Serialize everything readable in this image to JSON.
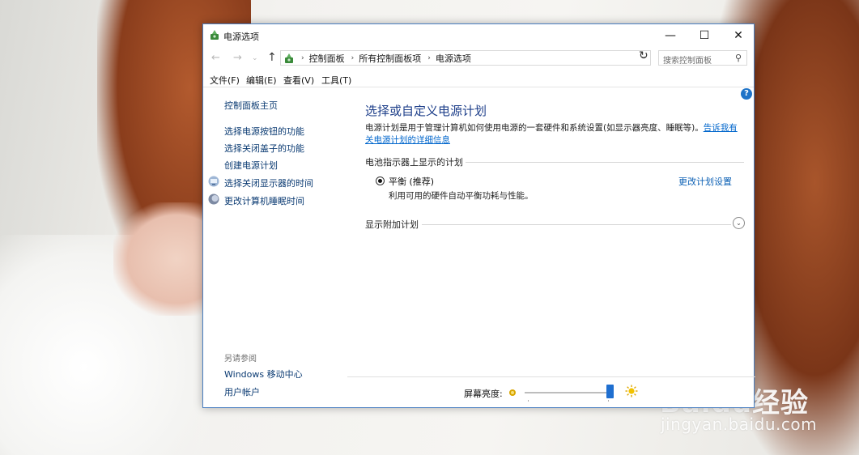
{
  "window": {
    "title": "电源选项",
    "min_glyph": "—",
    "max_glyph": "☐",
    "close_glyph": "✕"
  },
  "nav": {
    "back_glyph": "←",
    "forward_glyph": "→",
    "recent_glyph": "⌄",
    "up_glyph": "↑",
    "breadcrumbs": [
      "控制面板",
      "所有控制面板项",
      "电源选项"
    ],
    "sep_glyph": "›",
    "dropdown_glyph": "⌄",
    "refresh_glyph": "↻",
    "search_placeholder": "搜索控制面板",
    "search_glyph": "⚲"
  },
  "menu": [
    "文件(F)",
    "编辑(E)",
    "查看(V)",
    "工具(T)"
  ],
  "help_glyph": "?",
  "sidebar": {
    "home": "控制面板主页",
    "items": [
      "选择电源按钮的功能",
      "选择关闭盖子的功能",
      "创建电源计划",
      "选择关闭显示器的时间",
      "更改计算机睡眠时间"
    ],
    "see_also_title": "另请参阅",
    "see_also": [
      "Windows 移动中心",
      "用户帐户"
    ]
  },
  "main": {
    "heading": "选择或自定义电源计划",
    "description": "电源计划是用于管理计算机如何使用电源的一套硬件和系统设置(如显示器亮度、睡眠等)。",
    "description_link": "告诉我有关电源计划的详细信息",
    "battery_section": "电池指示器上显示的计划",
    "plan_name": "平衡 (推荐)",
    "plan_desc": "利用可用的硬件自动平衡功耗与性能。",
    "plan_selected": true,
    "change_link": "更改计划设置",
    "additional_section": "显示附加计划",
    "expand_glyph": "⌄",
    "brightness_label": "屏幕亮度:",
    "brightness_level": 1.0
  },
  "watermark": {
    "brand": "Baidu经验",
    "url": "jingyan.baidu.com"
  },
  "colors": {
    "accent": "#1f6fd0",
    "link": "#0a5fb4",
    "heading": "#1e3f8a",
    "window_border": "#4a7fc1"
  }
}
